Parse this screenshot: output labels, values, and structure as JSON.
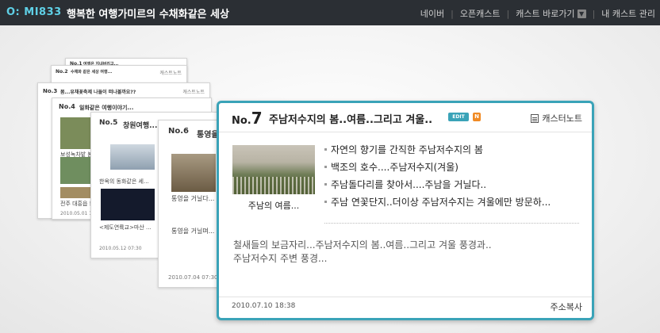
{
  "header": {
    "logo": "O: MI833",
    "title": "행복한 여행가미르의 수채화같은 세상",
    "nav": [
      "네이버",
      "오픈캐스트",
      "캐스트 바로가기",
      "내 캐스트 관리"
    ]
  },
  "back_cards": [
    {
      "no": "No.1",
      "title": "여행은 지내버리고...",
      "note": "캐스트노트"
    },
    {
      "no": "No.2",
      "title": "수채화 같은 세상 여행...",
      "note": "캐스트노트"
    },
    {
      "no": "No.3",
      "title": "봄...유채꽃축제 나들이 떠나볼까요??",
      "note": "캐스트노트"
    },
    {
      "no": "No.4",
      "title": "일화같은 여행이야기...",
      "captions": [
        "보성녹차밭 봄...",
        "전주 대흥읍 보..."
      ],
      "date": "2010.05.01 15:38"
    },
    {
      "no": "No.5",
      "title": "창원여행...",
      "captions": [
        "한옥의 동화같은 세...",
        "<제도연륙교>마산 ..."
      ],
      "date": "2010.05.12 07:30"
    },
    {
      "no": "No.6",
      "title": "통영을...",
      "captions": [
        "통영을 거닐다...",
        "통영을 거닐며..."
      ],
      "date": "2010.07.04 07:30"
    }
  ],
  "main_card": {
    "no_prefix": "No.",
    "no_num": "7",
    "title": "주남저수지의 봄..여름..그리고 겨울..",
    "edit_badge": "EDIT",
    "new_badge": "N",
    "notes_label": "캐스터노트",
    "thumb_caption": "주남의 여름...",
    "posts": [
      "자연의 향기를 간직한 주남저수지의 봄",
      "백조의 호수....주남저수지(겨울)",
      "주남돌다리를 찾아서....주남을 거닐다..",
      "주남 연꽃단지..더이상 주남저수지는 겨울에만 방문하..."
    ],
    "summary": "철새들의 보금자리...주남저수지의 봄..여름..그리고 겨울 풍경과..\n주남저수지 주변 풍경...",
    "date": "2010.07.10 18:38",
    "copy_label": "주소복사"
  },
  "colors": {
    "accent": "#3aa3b8",
    "new_badge": "#f08a24",
    "topbar": "#2b2f34"
  }
}
